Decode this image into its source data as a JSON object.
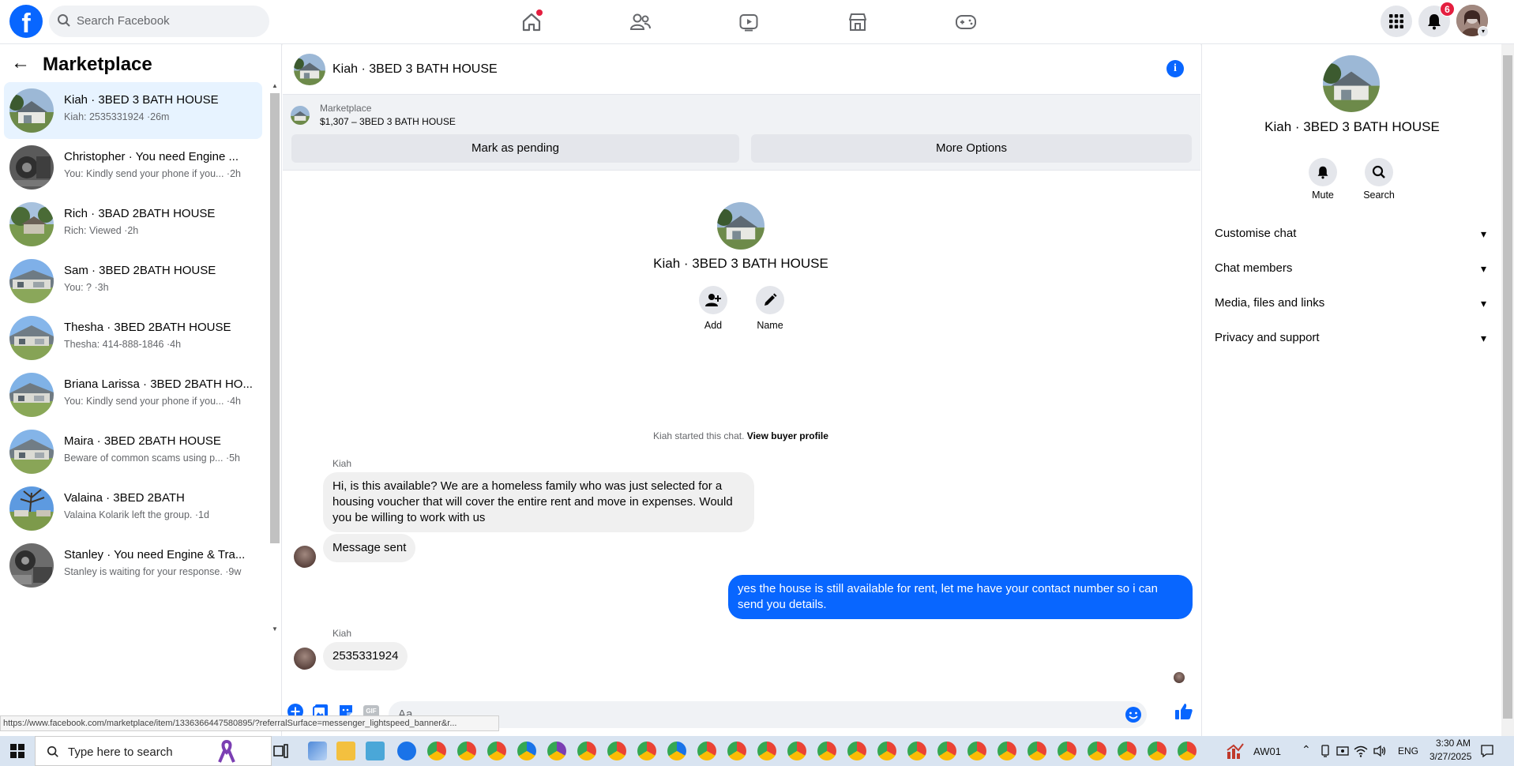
{
  "topbar": {
    "logo": "f",
    "search_placeholder": "Search Facebook",
    "notifications_count": "6"
  },
  "sidebar": {
    "title": "Marketplace",
    "conversations": [
      {
        "name": "Kiah · 3BED 3 BATH HOUSE",
        "preview": "Kiah: 2535331924 ·26m"
      },
      {
        "name": "Christopher · You need Engine ...",
        "preview": "You: Kindly send your phone if you... ·2h"
      },
      {
        "name": "Rich · 3BAD 2BATH HOUSE",
        "preview": "Rich: Viewed ·2h"
      },
      {
        "name": "Sam · 3BED 2BATH HOUSE",
        "preview": "You: ? ·3h"
      },
      {
        "name": "Thesha · 3BED 2BATH HOUSE",
        "preview": "Thesha: 414-888-1846 ·4h"
      },
      {
        "name": "Briana Larissa · 3BED 2BATH HO...",
        "preview": "You: Kindly send your phone if you... ·4h"
      },
      {
        "name": "Maira · 3BED 2BATH HOUSE",
        "preview": "Beware of common scams using p... ·5h"
      },
      {
        "name": "Valaina · 3BED 2BATH",
        "preview": "Valaina Kolarik left the group. ·1d"
      },
      {
        "name": "Stanley · You need Engine & Tra...",
        "preview": "Stanley is waiting for your response. ·9w"
      }
    ]
  },
  "chat": {
    "title": "Kiah · 3BED 3 BATH HOUSE",
    "marketplace_label": "Marketplace",
    "listing": "$1,307 – 3BED 3 BATH HOUSE",
    "mark_pending": "Mark as pending",
    "more_options": "More Options",
    "intro_name": "Kiah · 3BED 3 BATH HOUSE",
    "add_label": "Add",
    "name_label": "Name",
    "started_text": "Kiah started this chat.",
    "view_buyer": "View buyer profile",
    "sender1": "Kiah",
    "msg1": "Hi, is this available? We are a homeless family who was just selected for a housing voucher that will cover the entire rent and move in expenses. Would you be willing to work with us",
    "msg2": "Message sent",
    "msg3": "yes the house is still available for rent, let me have your contact number so i can send you details.",
    "sender2": "Kiah",
    "msg4": "2535331924",
    "composer_placeholder": "Aa",
    "gif": "GIF"
  },
  "status_url": "https://www.facebook.com/marketplace/item/1336366447580895/?referralSurface=messenger_lightspeed_banner&r...",
  "right_panel": {
    "name": "Kiah · 3BED 3 BATH HOUSE",
    "mute": "Mute",
    "search": "Search",
    "rows": [
      "Customise chat",
      "Chat members",
      "Media, files and links",
      "Privacy and support"
    ]
  },
  "taskbar": {
    "search_placeholder": "Type here to search",
    "tray_label": "AW01",
    "lang": "ENG",
    "time": "3:30 AM",
    "date": "3/27/2025"
  },
  "colors": {
    "brand": "#0866ff",
    "badge": "#e41e3f",
    "active_row": "#e7f3ff"
  }
}
